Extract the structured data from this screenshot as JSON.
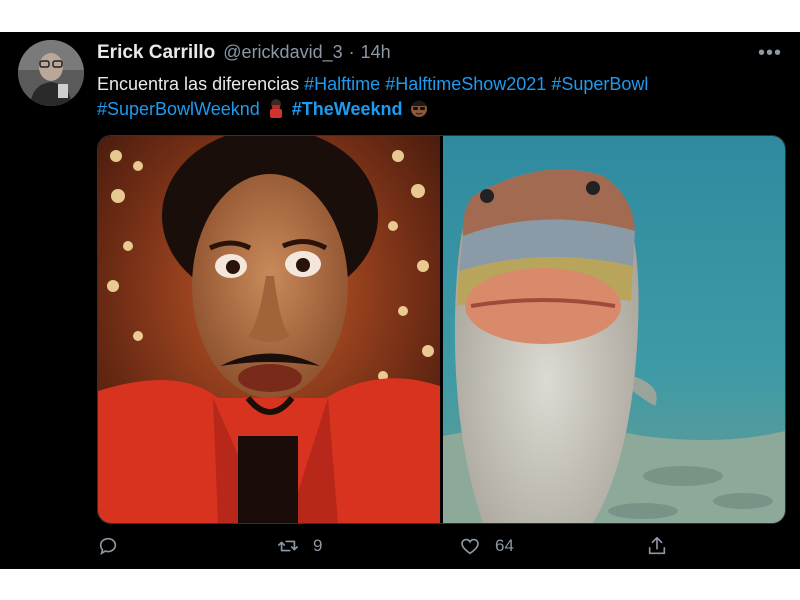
{
  "tweet": {
    "author_name": "Erick Carrillo",
    "handle": "@erickdavid_3",
    "separator": "·",
    "time": "14h",
    "more_label": "•••",
    "text_parts": {
      "lead": "Encuentra las diferencias",
      "tag1": "#Halftime",
      "tag2": "#HalftimeShow2021",
      "tag3": "#SuperBowl",
      "tag4": "#SuperBowlWeeknd",
      "tag5": "#TheWeeknd"
    },
    "emojis": [
      "mask-emoji",
      "sunglasses-face-emoji"
    ],
    "media": {
      "left": "photo-singer-red-jacket",
      "right": "photo-fish-underwater"
    },
    "actions": {
      "reply_count": "",
      "retweet_count": "9",
      "like_count": "64",
      "share_count": ""
    }
  },
  "colors": {
    "background": "#000000",
    "text": "#e7e9ea",
    "muted": "#8b98a5",
    "hashtag": "#1d9bf0"
  }
}
